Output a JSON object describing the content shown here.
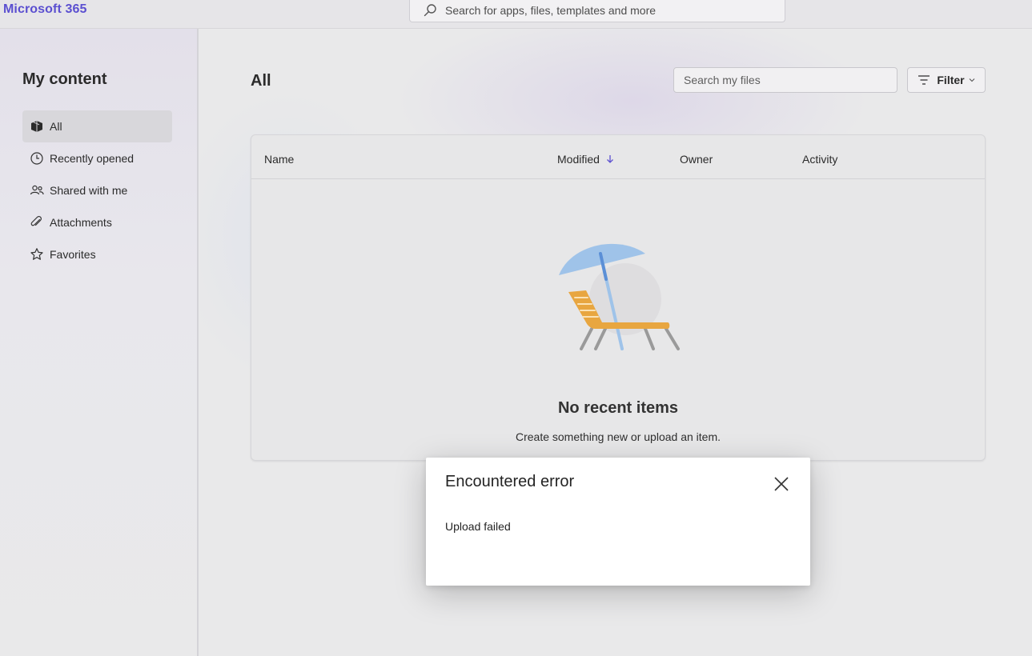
{
  "app": {
    "brand": "Microsoft 365"
  },
  "global_search": {
    "placeholder": "Search for apps, files, templates and more",
    "icon": "search-icon"
  },
  "sidebar": {
    "title": "My content",
    "items": [
      {
        "label": "All",
        "icon": "all-files-icon",
        "active": true
      },
      {
        "label": "Recently opened",
        "icon": "clock-icon",
        "active": false
      },
      {
        "label": "Shared with me",
        "icon": "people-icon",
        "active": false
      },
      {
        "label": "Attachments",
        "icon": "paperclip-icon",
        "active": false
      },
      {
        "label": "Favorites",
        "icon": "star-icon",
        "active": false
      }
    ]
  },
  "main": {
    "title": "All",
    "file_search": {
      "placeholder": "Search my files"
    },
    "filter": {
      "label": "Filter"
    },
    "table": {
      "columns": [
        "Name",
        "Modified",
        "Owner",
        "Activity"
      ],
      "sorted_by": "Modified",
      "sort_direction": "descending"
    },
    "empty_state": {
      "title": "No recent items",
      "subtitle": "Create something new or upload an item.",
      "illustration": "beach-chair-umbrella"
    }
  },
  "dialog": {
    "title": "Encountered error",
    "message": "Upload failed",
    "close_icon": "close-icon"
  },
  "colors": {
    "brand": "#5b4fd0",
    "accent_blue": "#5b8fd6",
    "chair_orange": "#e8a640"
  }
}
